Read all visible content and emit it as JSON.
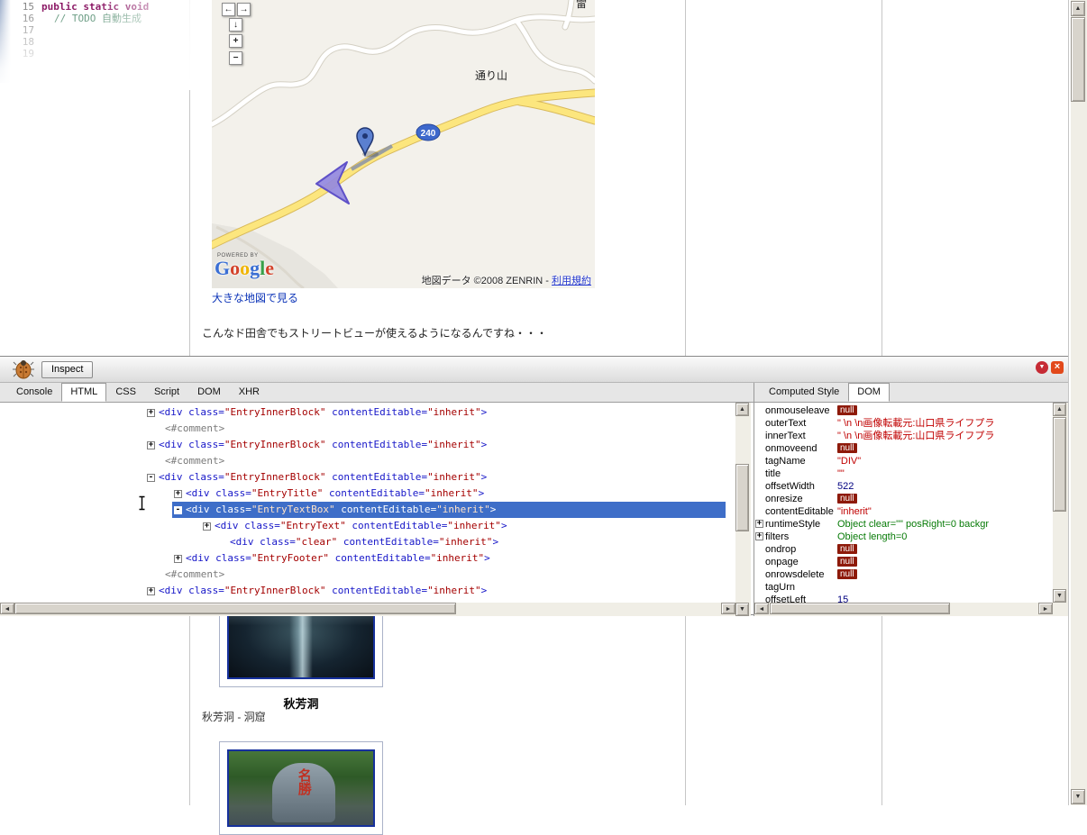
{
  "ghost_editor": {
    "lines": [
      {
        "num": "15",
        "code": "public static void",
        "style": "keyword",
        "indent": 0
      },
      {
        "num": "16",
        "code": "// TODO 自動生成",
        "style": "comment",
        "indent": 14
      },
      {
        "num": "17",
        "code": "",
        "style": "",
        "indent": 0
      },
      {
        "num": "18",
        "code": "",
        "style": "",
        "indent": 0
      },
      {
        "num": "19",
        "code": "",
        "style": "",
        "indent": 0
      }
    ]
  },
  "map": {
    "controls": {
      "pan_left": "←",
      "pan_right": "→",
      "pan_down": "↓",
      "zoom_in": "+",
      "zoom_out": "−"
    },
    "route_badge": "240",
    "labels": {
      "mountain": "通り山",
      "top_edge": "雷"
    },
    "powered_by": "POWERED BY",
    "logo_letters": [
      {
        "ch": "G",
        "color": "#3b6fd4"
      },
      {
        "ch": "o",
        "color": "#d3422a"
      },
      {
        "ch": "o",
        "color": "#f0b400"
      },
      {
        "ch": "g",
        "color": "#3b6fd4"
      },
      {
        "ch": "l",
        "color": "#38a049"
      },
      {
        "ch": "e",
        "color": "#d3422a"
      }
    ],
    "attribution": "地図データ ©2008 ZENRIN - ",
    "attribution_link": "利用規約"
  },
  "blog": {
    "map_link": "大きな地図で見る",
    "comment": "こんなド田舎でもストリートビューが使えるようになるんですね・・・",
    "photo1_caption": "秋芳洞",
    "photo1_sub": "秋芳洞 - 洞窟",
    "photo2_stone": "名勝"
  },
  "firebug": {
    "inspect": "Inspect",
    "tabs": [
      "Console",
      "HTML",
      "CSS",
      "Script",
      "DOM",
      "XHR"
    ],
    "active_tab": "HTML",
    "right_tabs": [
      "Computed Style",
      "DOM"
    ],
    "right_active": "DOM",
    "tree": [
      {
        "indent": 163,
        "exp": "+",
        "tag": "div",
        "attrs": [
          [
            "class",
            "EntryInnerBlock"
          ],
          [
            "contentEditable",
            "inherit"
          ]
        ]
      },
      {
        "indent": 183,
        "comment": "<#comment>"
      },
      {
        "indent": 163,
        "exp": "+",
        "tag": "div",
        "attrs": [
          [
            "class",
            "EntryInnerBlock"
          ],
          [
            "contentEditable",
            "inherit"
          ]
        ]
      },
      {
        "indent": 183,
        "comment": "<#comment>"
      },
      {
        "indent": 163,
        "exp": "-",
        "tag": "div",
        "attrs": [
          [
            "class",
            "EntryInnerBlock"
          ],
          [
            "contentEditable",
            "inherit"
          ]
        ]
      },
      {
        "indent": 193,
        "exp": "+",
        "tag": "div",
        "attrs": [
          [
            "class",
            "EntryTitle"
          ],
          [
            "contentEditable",
            "inherit"
          ]
        ]
      },
      {
        "indent": 193,
        "exp": "-",
        "tag": "div",
        "attrs": [
          [
            "class",
            "EntryTextBox"
          ],
          [
            "contentEditable",
            "inherit"
          ]
        ],
        "selected": true
      },
      {
        "indent": 225,
        "exp": "+",
        "tag": "div",
        "attrs": [
          [
            "class",
            "EntryText"
          ],
          [
            "contentEditable",
            "inherit"
          ]
        ]
      },
      {
        "indent": 255,
        "exp": null,
        "tag": "div",
        "attrs": [
          [
            "class",
            "clear"
          ],
          [
            "contentEditable",
            "inherit"
          ]
        ]
      },
      {
        "indent": 193,
        "exp": "+",
        "tag": "div",
        "attrs": [
          [
            "class",
            "EntryFooter"
          ],
          [
            "contentEditable",
            "inherit"
          ]
        ]
      },
      {
        "indent": 183,
        "comment": "<#comment>"
      },
      {
        "indent": 163,
        "exp": "+",
        "tag": "div",
        "attrs": [
          [
            "class",
            "EntryInnerBlock"
          ],
          [
            "contentEditable",
            "inherit"
          ]
        ]
      },
      {
        "indent": 183,
        "comment": "<#comment>"
      }
    ],
    "dom_rows": [
      {
        "name": "onmouseleave",
        "value": "null",
        "kind": "null"
      },
      {
        "name": "outerText",
        "value": "\" \\n \\n画像転載元:山口県ライフプラ",
        "kind": "string"
      },
      {
        "name": "innerText",
        "value": "\" \\n \\n画像転載元:山口県ライフプラ",
        "kind": "string"
      },
      {
        "name": "onmoveend",
        "value": "null",
        "kind": "null"
      },
      {
        "name": "tagName",
        "value": "\"DIV\"",
        "kind": "string"
      },
      {
        "name": "title",
        "value": "\"\"",
        "kind": "string"
      },
      {
        "name": "offsetWidth",
        "value": "522",
        "kind": "number"
      },
      {
        "name": "onresize",
        "value": "null",
        "kind": "null"
      },
      {
        "name": "contentEditable",
        "value": "\"inherit\"",
        "kind": "string"
      },
      {
        "name": "runtimeStyle",
        "value": "Object clear=\"\" posRight=0 backgr",
        "kind": "object",
        "exp": true
      },
      {
        "name": "filters",
        "value": "Object length=0",
        "kind": "object",
        "exp": true
      },
      {
        "name": "ondrop",
        "value": "null",
        "kind": "null"
      },
      {
        "name": "onpage",
        "value": "null",
        "kind": "null"
      },
      {
        "name": "onrowsdelete",
        "value": "null",
        "kind": "null"
      },
      {
        "name": "tagUrn",
        "value": "",
        "kind": "empty"
      },
      {
        "name": "offsetLeft",
        "value": "15",
        "kind": "number"
      }
    ]
  },
  "icons": {
    "scroll_up": "▲",
    "scroll_down": "▼",
    "scroll_left": "◄",
    "scroll_right": "►",
    "minimize": "▼",
    "close": "×"
  },
  "colors": {
    "selection_blue": "#3E6EC8",
    "null_badge": "#8E1A0A",
    "yellow_road": "#FCE67E",
    "route_badge_blue": "#3D68CC"
  }
}
